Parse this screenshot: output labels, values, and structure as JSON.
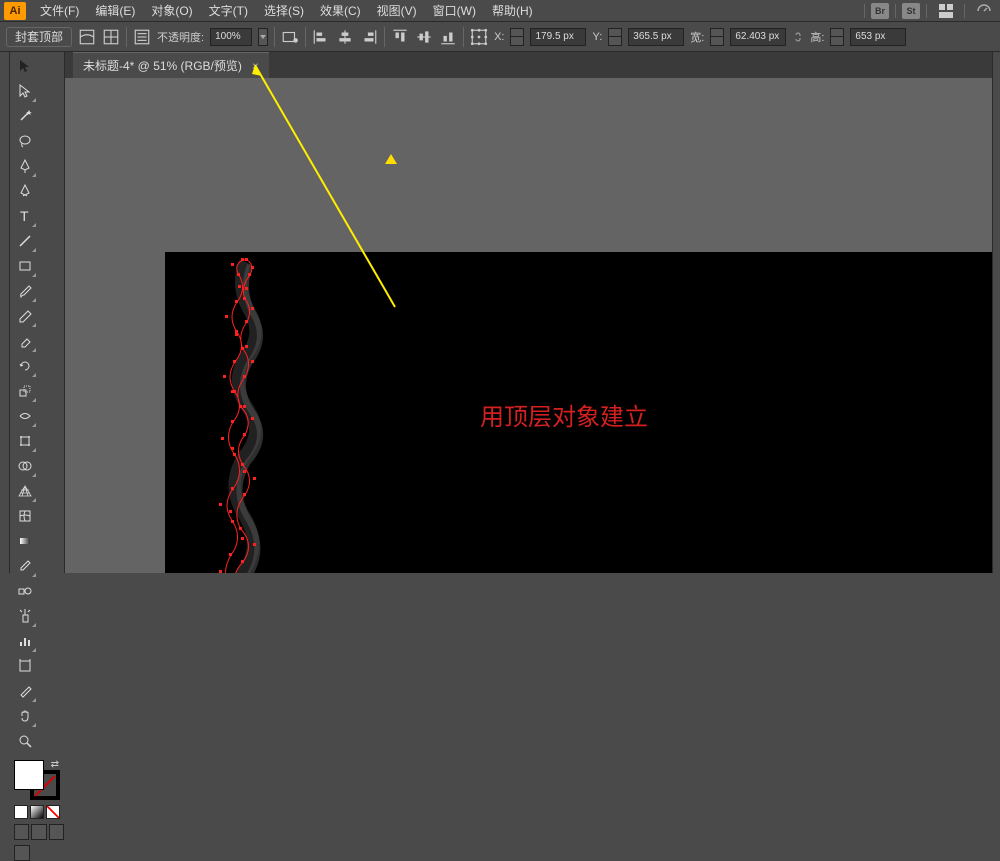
{
  "menu": {
    "file": "文件(F)",
    "edit": "编辑(E)",
    "object": "对象(O)",
    "type": "文字(T)",
    "select": "选择(S)",
    "effect": "效果(C)",
    "view": "视图(V)",
    "window": "窗口(W)",
    "help": "帮助(H)"
  },
  "optbar": {
    "tool_label": "封套顶部",
    "opacity_label": "不透明度:",
    "opacity_value": "100%",
    "x_label": "X:",
    "x_value": "179.5 px",
    "y_label": "Y:",
    "y_value": "365.5 px",
    "w_label": "宽:",
    "w_value": "62.403 px",
    "h_label": "高:",
    "h_value": "653 px"
  },
  "tab": {
    "title": "未标题-4* @ 51% (RGB/预览)"
  },
  "canvas": {
    "annotation": "用顶层对象建立"
  }
}
